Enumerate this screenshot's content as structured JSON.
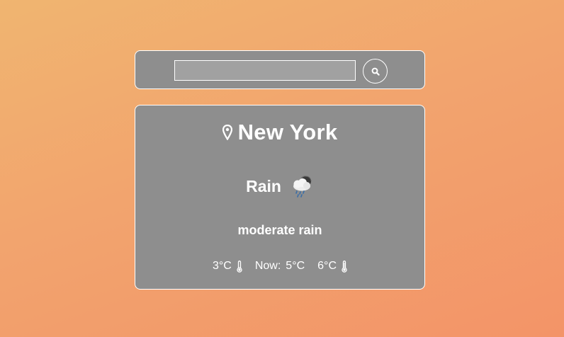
{
  "search": {
    "value": "",
    "placeholder": "",
    "button_icon": "search-icon"
  },
  "location": {
    "icon": "map-pin-icon",
    "city": "New York"
  },
  "weather": {
    "condition": "Rain",
    "condition_icon": "rain-cloud-icon",
    "description": "moderate rain"
  },
  "temperatures": {
    "min": "3°C",
    "min_icon": "thermometer-low-icon",
    "now_label": "Now:",
    "current": "5°C",
    "max": "6°C",
    "max_icon": "thermometer-high-icon"
  },
  "colors": {
    "panel": "#8e8e8e",
    "input": "#a1a1a1",
    "border": "#ffffff",
    "text": "#ffffff",
    "background_start": "#f0b570",
    "background_end": "#f39468"
  }
}
